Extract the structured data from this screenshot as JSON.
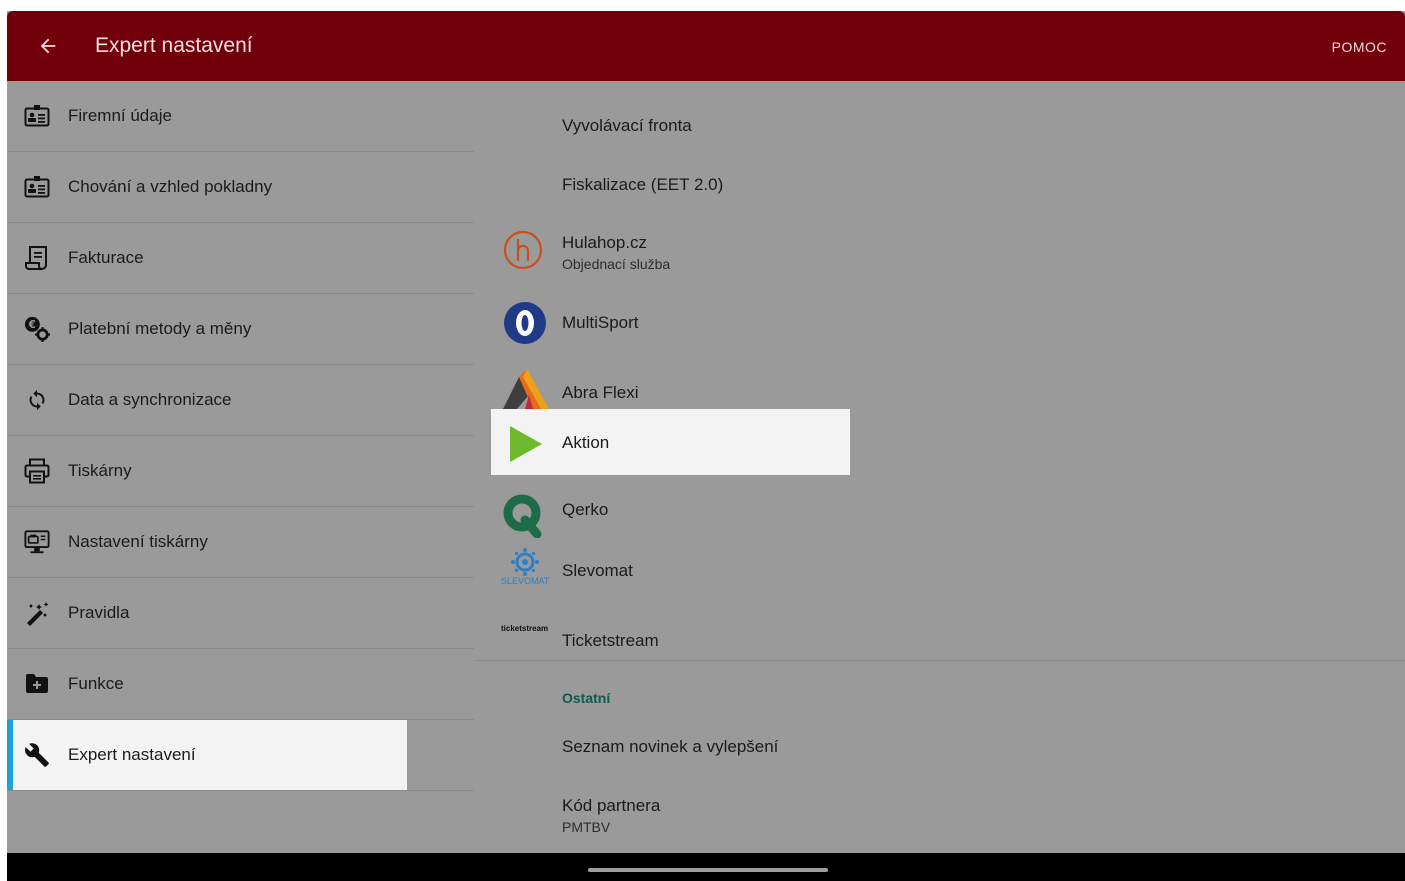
{
  "app_bar": {
    "title": "Expert nastavení",
    "help_label": "POMOC",
    "back_icon": "arrow-left-icon"
  },
  "sidebar": {
    "items": [
      {
        "label": "Firemní údaje",
        "icon": "id-card-icon"
      },
      {
        "label": "Chování a vzhled pokladny",
        "icon": "id-card-icon"
      },
      {
        "label": "Fakturace",
        "icon": "invoice-icon"
      },
      {
        "label": "Platební metody a měny",
        "icon": "euro-gear-icon"
      },
      {
        "label": "Data a synchronizace",
        "icon": "sync-icon"
      },
      {
        "label": "Tiskárny",
        "icon": "printer-icon"
      },
      {
        "label": "Nastavení tiskárny",
        "icon": "printer-settings-icon"
      },
      {
        "label": "Pravidla",
        "icon": "magic-wand-icon"
      },
      {
        "label": "Funkce",
        "icon": "folder-plus-icon"
      },
      {
        "label": "Expert nastavení",
        "icon": "wrench-icon",
        "selected": true
      }
    ]
  },
  "content": {
    "items": [
      {
        "label": "Vyvolávací fronta"
      },
      {
        "label": "Fiskalizace (EET 2.0)"
      },
      {
        "label": "Hulahop.cz",
        "sublabel": "Objednací služba",
        "logo": "hulahop-logo-icon"
      },
      {
        "label": "MultiSport",
        "logo": "multisport-logo-icon"
      },
      {
        "label": "Abra Flexi",
        "logo": "abra-flexi-logo-icon"
      },
      {
        "label": "Aktion",
        "logo": "aktion-logo-icon",
        "selected": true
      },
      {
        "label": "Qerko",
        "logo": "qerko-logo-icon"
      },
      {
        "label": "Slevomat",
        "logo": "slevomat-logo-icon",
        "logo_text": "SLEVOMAT"
      },
      {
        "label": "Ticketstream",
        "logo": "ticketstream-logo-icon",
        "logo_text": "ticketstream"
      }
    ],
    "section_title": "Ostatní",
    "other_items": [
      {
        "label": "Seznam novinek a vylepšení"
      },
      {
        "label": "Kód partnera",
        "sublabel": "PMTBV"
      }
    ]
  },
  "colors": {
    "app_bar": "#72000b",
    "overlay_background": "#9a9a9a",
    "selected_accent": "#1da1d9",
    "section_title": "#0e5a4a"
  }
}
